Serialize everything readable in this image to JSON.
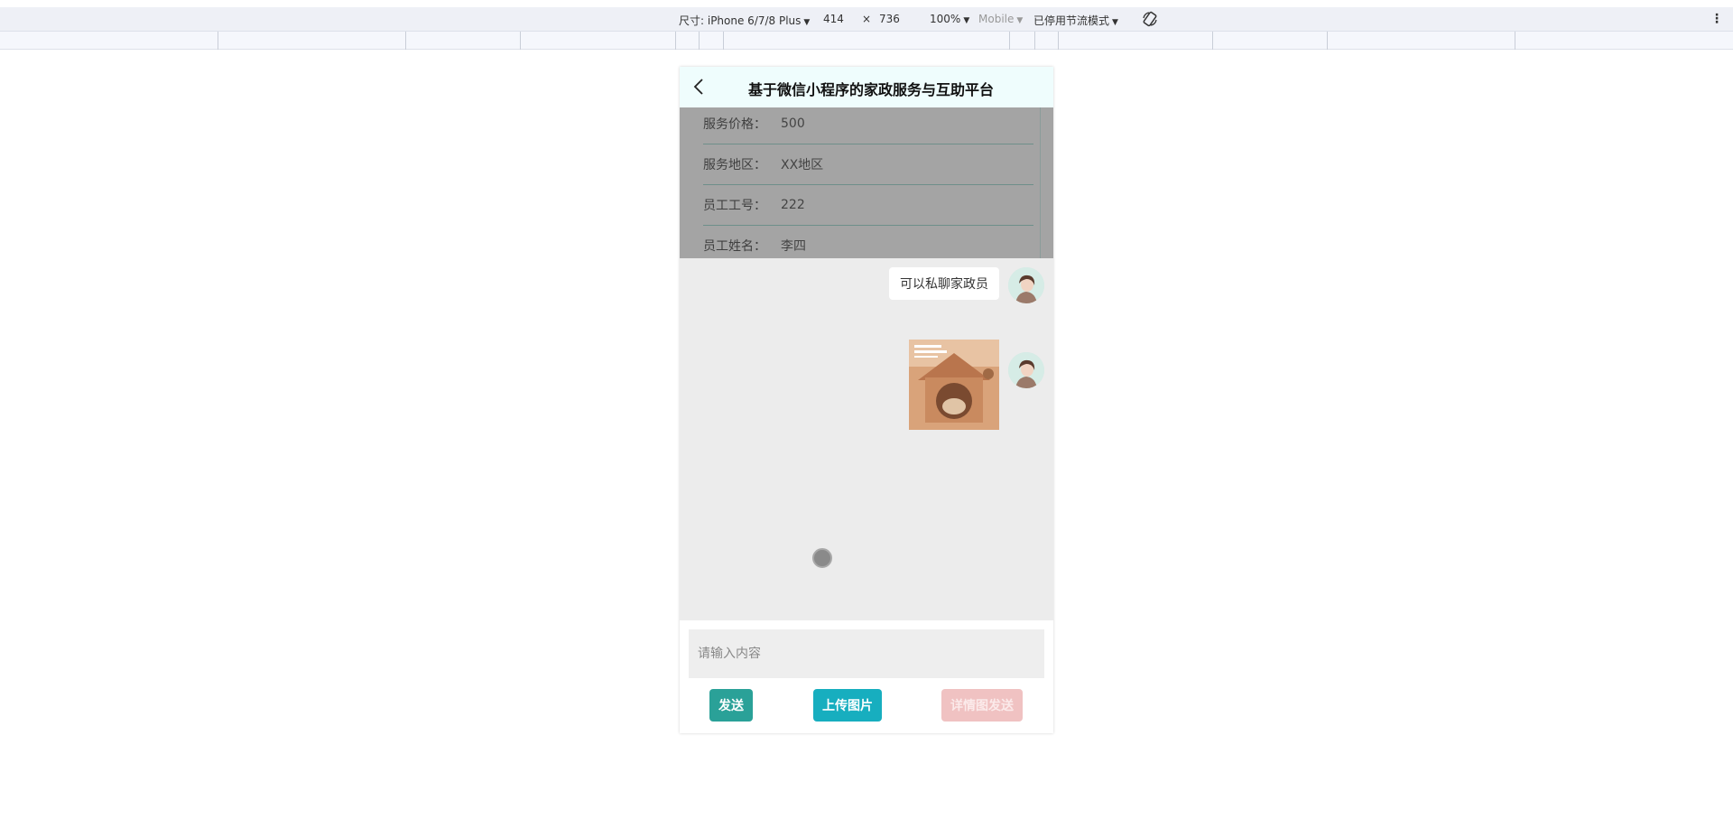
{
  "devtools": {
    "size_label": "尺寸: iPhone 6/7/8 Plus",
    "width": "414",
    "times": "×",
    "height": "736",
    "zoom": "100%",
    "mode": "Mobile",
    "throttle": "已停用节流模式"
  },
  "nav": {
    "title": "基于微信小程序的家政服务与互助平台"
  },
  "info": {
    "rows": [
      {
        "key": "服务价格：",
        "value": "500"
      },
      {
        "key": "服务地区：",
        "value": "XX地区"
      },
      {
        "key": "员工工号：",
        "value": "222"
      },
      {
        "key": "员工姓名：",
        "value": "李四"
      }
    ]
  },
  "chat": {
    "messages": [
      {
        "type": "text",
        "text": "可以私聊家政员"
      },
      {
        "type": "image"
      }
    ]
  },
  "composer": {
    "placeholder": "请输入内容",
    "send_label": "发送",
    "upload_label": "上传图片",
    "detail_label": "详情图发送"
  },
  "colors": {
    "send": "#2aa198",
    "upload": "#17aebf",
    "detail": "#f0c2c2",
    "nav_bg": "#effdfd"
  }
}
